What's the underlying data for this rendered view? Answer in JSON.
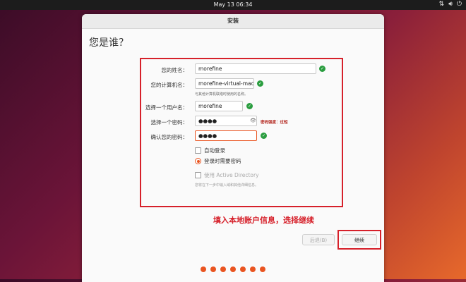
{
  "topbar": {
    "clock": "May 13  06:34",
    "icons": [
      "network-icon",
      "volume-icon",
      "power-icon"
    ]
  },
  "window": {
    "title": "安装",
    "heading": "您是谁？"
  },
  "form": {
    "name_label": "您的姓名：",
    "name_value": "morefine",
    "computer_label": "您的计算机名：",
    "computer_value": "morefine-virtual-machi",
    "computer_hint": "与其他计算机联络时使用的名称。",
    "user_label": "选择一个用户名：",
    "user_value": "morefine",
    "password_label": "选择一个密码：",
    "password_value": "●●●●",
    "password_strength": "密码强度：过短",
    "confirm_label": "确认您的密码：",
    "confirm_value": "●●●●",
    "auto_login": "自动登录",
    "require_password": "登录时需要密码",
    "active_directory": "使用 Active Directory",
    "ad_hint": "您将在下一步中输入域和其他详细信息。"
  },
  "annotation": "填入本地账户信息，选择继续",
  "buttons": {
    "back": "后退(B)",
    "continue": "继续"
  },
  "progress": {
    "steps": 7
  },
  "colors": {
    "accent": "#e95420",
    "highlight": "#d6202a",
    "ok": "#2a9d3f"
  }
}
